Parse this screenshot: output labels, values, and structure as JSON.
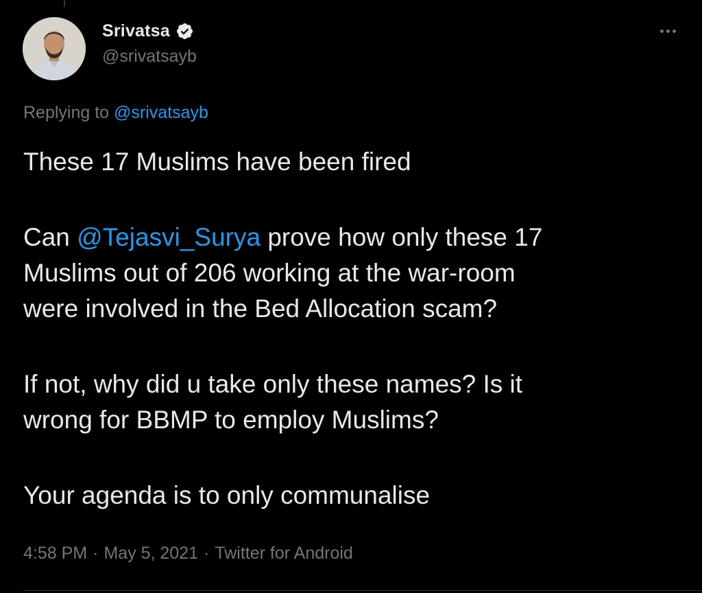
{
  "colors": {
    "background": "#000000",
    "text_primary": "#e7e9ea",
    "text_secondary": "#71767b",
    "link": "#1d9bf0",
    "verified_badge": "#e7e9ea"
  },
  "author": {
    "display_name": "Srivatsa",
    "handle": "@srivatsayb",
    "verified": true,
    "avatar_icon": "profile-photo"
  },
  "more_menu_icon": "more-horizontal-icon",
  "replying": {
    "prefix": "Replying to ",
    "mention": "@srivatsayb"
  },
  "tweet": {
    "para1": "These 17 Muslims have been fired",
    "para2_prefix": "Can ",
    "para2_mention": "@Tejasvi_Surya",
    "para2_line1_rest": " prove how only these 17",
    "para2_line2": "Muslims out of 206 working at the war-room",
    "para2_line3": "were involved in the Bed Allocation scam?",
    "para3_line1": "If not, why did u take only these names? Is it",
    "para3_line2": "wrong for BBMP to employ Muslims?",
    "para4": "Your agenda is to only communalise"
  },
  "meta": {
    "time": "4:58 PM",
    "separator": "·",
    "date": "May 5, 2021",
    "source": "Twitter for Android"
  }
}
